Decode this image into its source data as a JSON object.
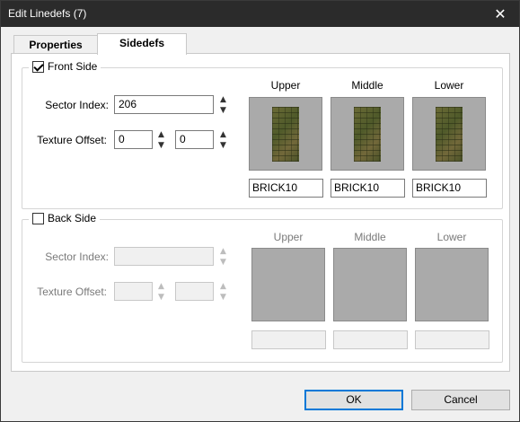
{
  "window": {
    "title": "Edit Linedefs (7)",
    "close_glyph": "✕"
  },
  "tabs": [
    {
      "label": "Properties",
      "active": false
    },
    {
      "label": "Sidedefs",
      "active": true
    }
  ],
  "front": {
    "label": "Front Side",
    "checked": true,
    "sector_label": "Sector Index:",
    "sector_value": "206",
    "offset_label": "Texture Offset:",
    "offset_x": "0",
    "offset_y": "0",
    "textures": [
      {
        "header": "Upper",
        "name": "BRICK10"
      },
      {
        "header": "Middle",
        "name": "BRICK10"
      },
      {
        "header": "Lower",
        "name": "BRICK10"
      }
    ]
  },
  "back": {
    "label": "Back Side",
    "checked": false,
    "sector_label": "Sector Index:",
    "sector_value": "",
    "offset_label": "Texture Offset:",
    "offset_x": "",
    "offset_y": "",
    "textures": [
      {
        "header": "Upper",
        "name": ""
      },
      {
        "header": "Middle",
        "name": ""
      },
      {
        "header": "Lower",
        "name": ""
      }
    ]
  },
  "buttons": {
    "ok": "OK",
    "cancel": "Cancel"
  },
  "icons": {
    "spin_up": "▲",
    "spin_down": "▼",
    "close": "close-icon",
    "checkbox": "checkmark-icon"
  },
  "colors": {
    "titlebar": "#2b2b2b",
    "default_button_border": "#0078d7",
    "empty_texture": "#aaaaaa"
  }
}
